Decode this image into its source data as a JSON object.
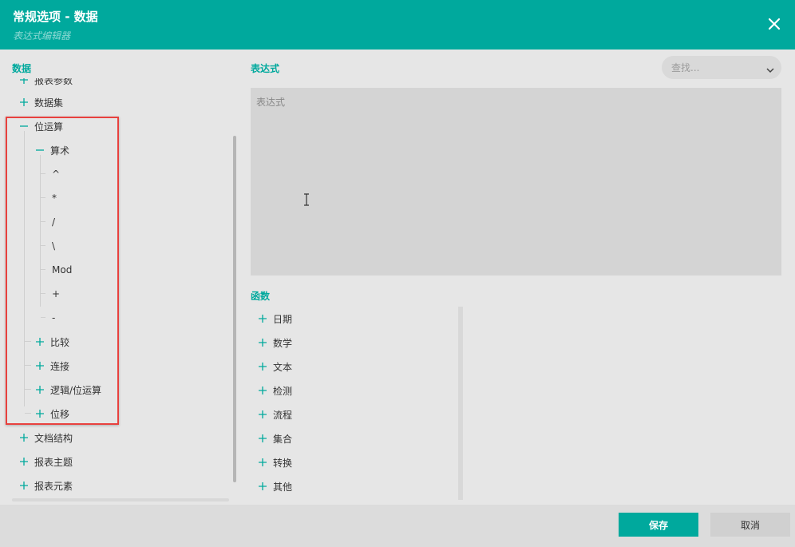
{
  "dialog": {
    "title": "常规选项 - 数据",
    "subtitle": "表达式编辑器"
  },
  "data_panel": {
    "title": "数据",
    "tree": [
      {
        "label": "报表参数",
        "toggle": "plus",
        "level": 0
      },
      {
        "label": "数据集",
        "toggle": "plus",
        "level": 0
      },
      {
        "label": "位运算",
        "toggle": "minus",
        "level": 0
      },
      {
        "label": "算术",
        "toggle": "minus",
        "level": 1
      },
      {
        "label": "^",
        "toggle": "none",
        "level": 2
      },
      {
        "label": "*",
        "toggle": "none",
        "level": 2
      },
      {
        "label": "/",
        "toggle": "none",
        "level": 2
      },
      {
        "label": "\\",
        "toggle": "none",
        "level": 2
      },
      {
        "label": "Mod",
        "toggle": "none",
        "level": 2
      },
      {
        "label": "+",
        "toggle": "none",
        "level": 2
      },
      {
        "label": "-",
        "toggle": "none",
        "level": 2
      },
      {
        "label": "比较",
        "toggle": "plus",
        "level": 1
      },
      {
        "label": "连接",
        "toggle": "plus",
        "level": 1
      },
      {
        "label": "逻辑/位运算",
        "toggle": "plus",
        "level": 1
      },
      {
        "label": "位移",
        "toggle": "plus",
        "level": 1
      },
      {
        "label": "文档结构",
        "toggle": "plus",
        "level": 0
      },
      {
        "label": "报表主题",
        "toggle": "plus",
        "level": 0
      },
      {
        "label": "报表元素",
        "toggle": "plus",
        "level": 0
      }
    ]
  },
  "expression": {
    "title": "表达式",
    "placeholder": "表达式",
    "value": ""
  },
  "search": {
    "placeholder": "查找..."
  },
  "functions": {
    "title": "函数",
    "items": [
      "日期",
      "数学",
      "文本",
      "检测",
      "流程",
      "集合",
      "转换",
      "其他"
    ]
  },
  "footer": {
    "save_label": "保存",
    "cancel_label": "取消"
  },
  "colors": {
    "accent": "#00a99d",
    "highlight_box": "#e8413e"
  },
  "icons": {
    "close": "close-icon",
    "expand": "plus-icon",
    "collapse": "minus-icon",
    "dropdown": "chevron-down-icon",
    "text_cursor": "ibeam-cursor-icon"
  }
}
